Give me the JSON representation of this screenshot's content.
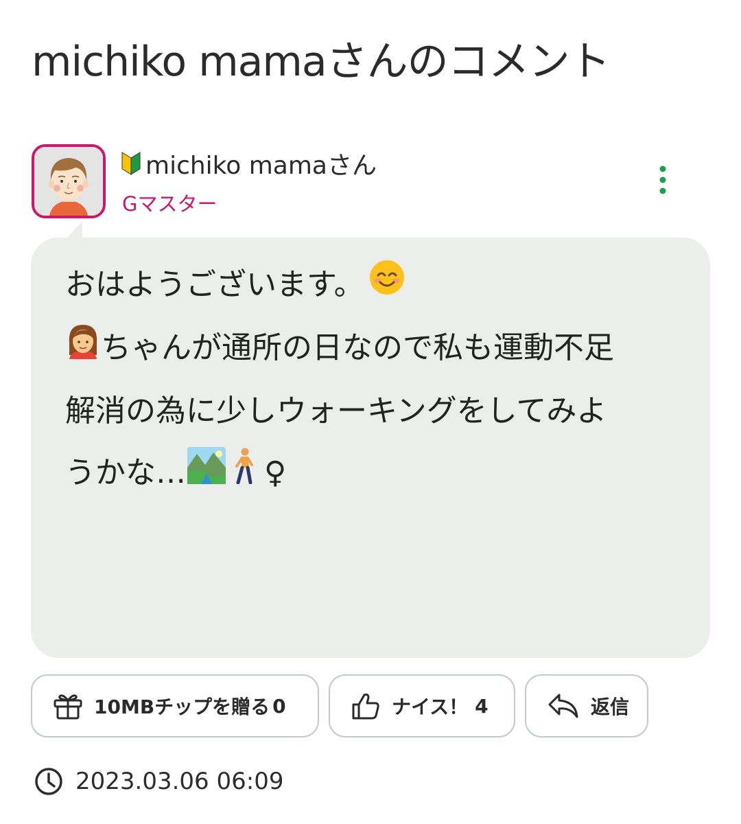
{
  "header": {
    "title": "michiko mamaさんのコメント"
  },
  "user": {
    "name": "michiko mamaさん",
    "rank": "Gマスター",
    "badge_icon": "beginner-mark-icon",
    "avatar_icon": "avatar-illustration",
    "accent_color": "#c8196a"
  },
  "comment": {
    "lines": [
      "おはようございます。",
      "ちゃんが通所の日なので私も運動不足",
      "解消の為に少しウォーキングをしてみよ",
      "うかな…"
    ],
    "emojis": [
      "smiling-face-emoji",
      "woman-emoji",
      "national-park-emoji",
      "person-walking-emoji",
      "female-sign"
    ],
    "trailing_symbol": "♀"
  },
  "actions": {
    "gift_label": "10MBチップを贈る",
    "gift_count": "0",
    "nice_label": "ナイス！",
    "nice_count": "4",
    "reply_label": "返信"
  },
  "meta": {
    "timestamp": "2023.03.06 06:09"
  },
  "colors": {
    "bubble_bg": "#ebeeeb",
    "more_icon": "#1aa04a",
    "button_border": "#c4cbc7"
  }
}
